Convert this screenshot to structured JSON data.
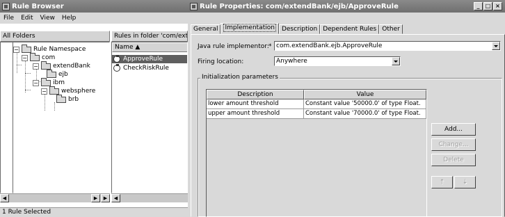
{
  "browser": {
    "title": "Rule Browser",
    "menu": [
      "File",
      "Edit",
      "View",
      "Help"
    ],
    "folders_header": "All Folders",
    "rules_header": "Rules in folder 'com/exter",
    "name_column": "Name ▲",
    "tree": [
      "Rule Namespace",
      "com",
      "extendBank",
      "ejb",
      "ibm",
      "websphere",
      "brb"
    ],
    "rules": [
      "ApproveRule",
      "CheckRiskRule"
    ],
    "status": "1 Rule Selected"
  },
  "props": {
    "title": "Rule Properties: com/extendBank/ejb/ApproveRule",
    "tabs": [
      "General",
      "Implementation",
      "Description",
      "Dependent Rules",
      "Other"
    ],
    "active_tab": "Implementation",
    "implementor_label": "Java rule implementor:",
    "required_mark": "*",
    "implementor_value": "com.extendBank.ejb.ApproveRule",
    "firing_label": "Firing location:",
    "firing_value": "Anywhere",
    "init_params_title": "Initialization parameters",
    "table": {
      "headers": [
        "Description",
        "Value"
      ],
      "rows": [
        [
          "lower amount threshold",
          "Constant value '50000.0' of type Float."
        ],
        [
          "upper amount threshold",
          "Constant value '70000.0' of type Float."
        ]
      ]
    },
    "buttons": {
      "add": "Add...",
      "change": "Change...",
      "delete": "Delete",
      "up": "⇡",
      "down": "⇣"
    }
  },
  "colors": {
    "titlebar": "#7a7a7a",
    "chrome": "#d9d9d9",
    "selection": "#5f5f5f"
  }
}
